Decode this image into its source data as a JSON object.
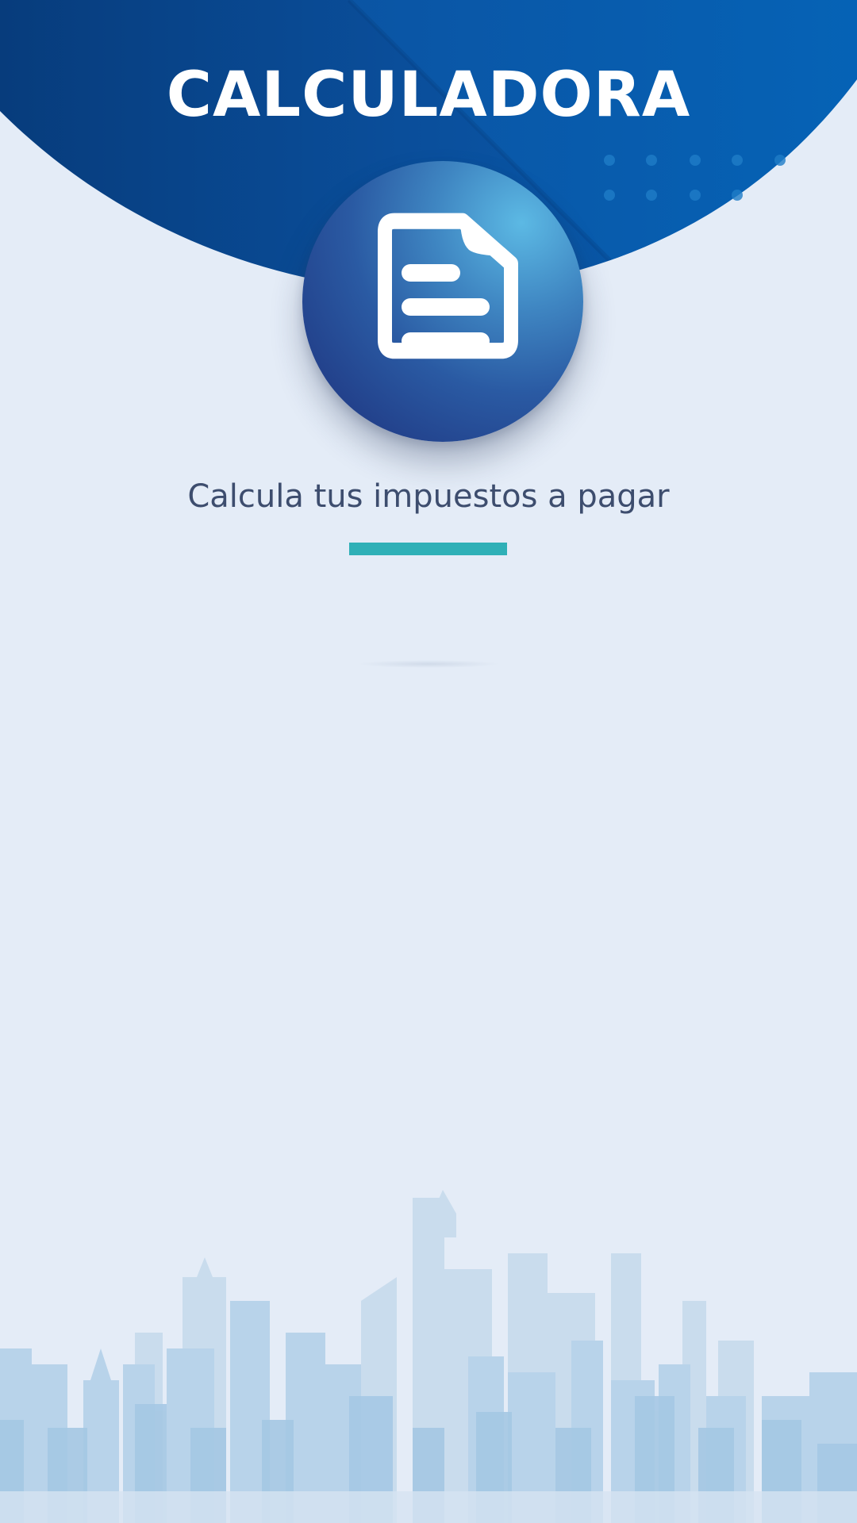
{
  "app": {
    "title": "CALCULADORA",
    "subtitle": "Calcula tus impuestos a pagar"
  },
  "icons": {
    "badge": "document-icon",
    "background": "city-skyline"
  },
  "colors": {
    "primary_blue": "#0a4e99",
    "accent_teal": "#2fb0b7",
    "background": "#e4ecf7",
    "text": "#3d4d6e"
  }
}
